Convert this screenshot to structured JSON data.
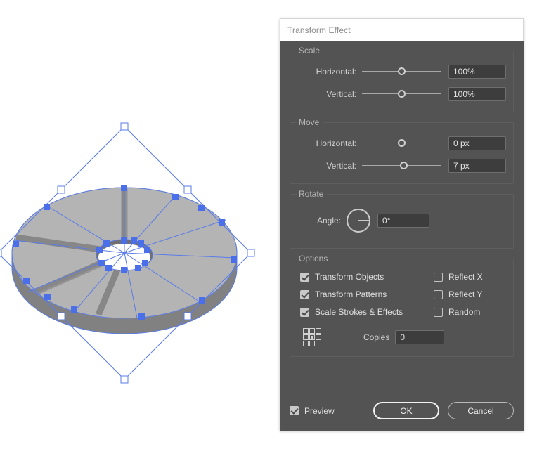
{
  "window": {
    "title": "Transform Effect"
  },
  "artwork": {
    "name": "3d-slotted-disc",
    "description": "Isometric grey slotted disc with selection bounding box",
    "colors": {
      "face": "#b4b4b4",
      "slot": "#868686",
      "rim": "#8a8a8a",
      "side": "#7e7e7e",
      "hole": "#ffffff",
      "selection": "#4a6fe8"
    }
  },
  "scale": {
    "title": "Scale",
    "horizontal": {
      "label": "Horizontal:",
      "value": "100%",
      "knob_pct": 50
    },
    "vertical": {
      "label": "Vertical:",
      "value": "100%",
      "knob_pct": 50
    }
  },
  "move": {
    "title": "Move",
    "horizontal": {
      "label": "Horizontal:",
      "value": "0 px",
      "knob_pct": 50
    },
    "vertical": {
      "label": "Vertical:",
      "value": "7 px",
      "knob_pct": 53
    }
  },
  "rotate": {
    "title": "Rotate",
    "angle_label": "Angle:",
    "angle_value": "0°"
  },
  "options": {
    "title": "Options",
    "checkboxes": [
      {
        "label": "Transform Objects",
        "checked": true
      },
      {
        "label": "Reflect X",
        "checked": false
      },
      {
        "label": "Transform Patterns",
        "checked": true
      },
      {
        "label": "Reflect Y",
        "checked": false
      },
      {
        "label": "Scale Strokes & Effects",
        "checked": true
      },
      {
        "label": "Random",
        "checked": false
      }
    ],
    "anchor": {
      "name": "anchor-point-grid",
      "active_index": 4
    },
    "copies_label": "Copies",
    "copies_value": "0"
  },
  "footer": {
    "preview_label": "Preview",
    "preview_checked": true,
    "ok_label": "OK",
    "cancel_label": "Cancel"
  }
}
